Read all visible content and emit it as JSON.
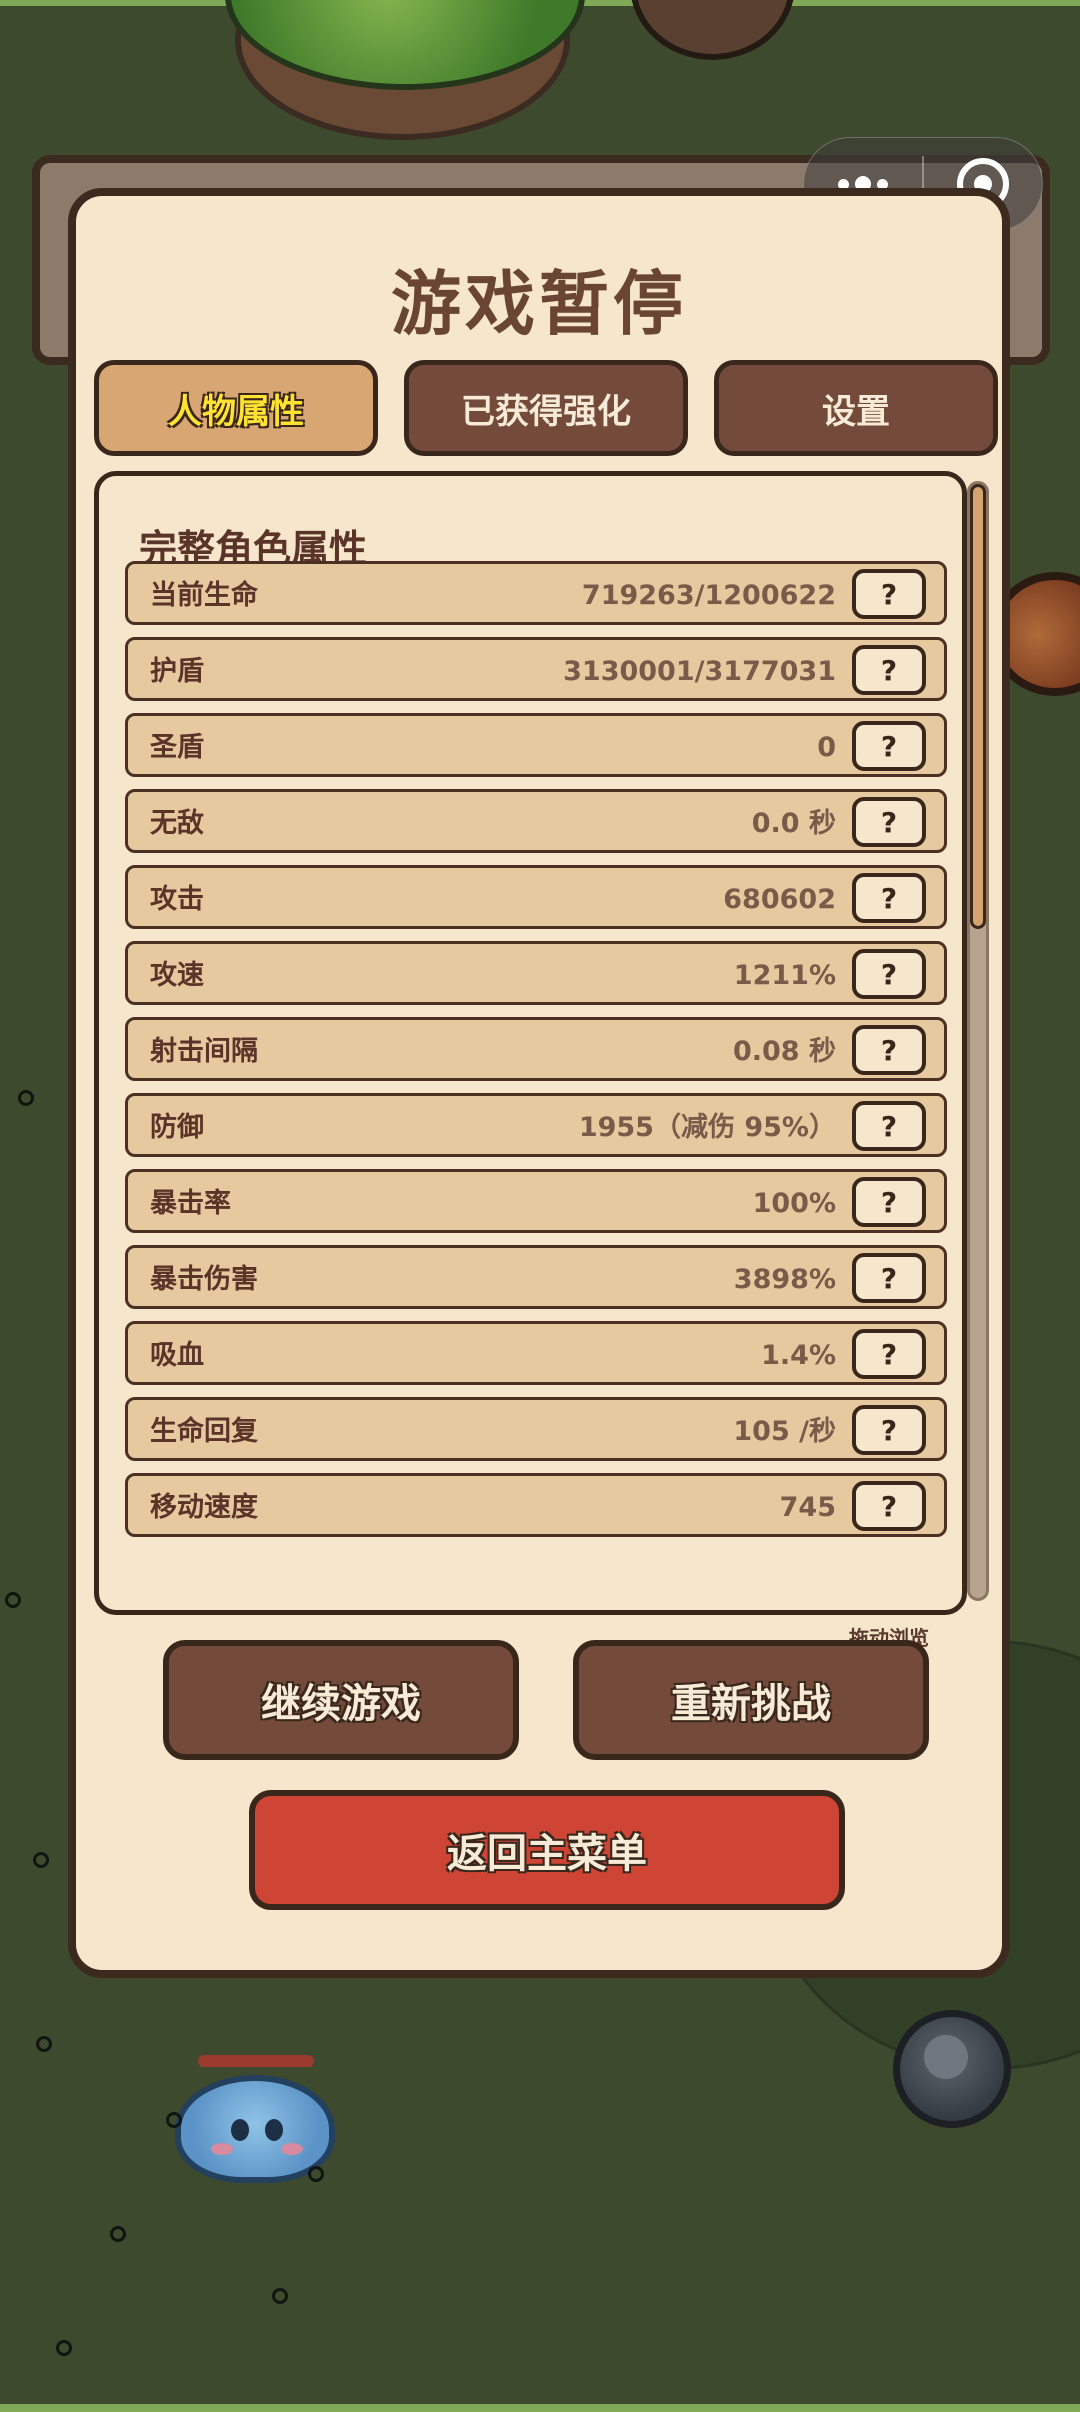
{
  "screen": {
    "title": "游戏暂停"
  },
  "tabs": [
    {
      "label": "人物属性",
      "active": true
    },
    {
      "label": "已获得强化",
      "active": false
    },
    {
      "label": "设置",
      "active": false
    }
  ],
  "stats": {
    "heading": "完整角色属性",
    "help_label": "?",
    "rows": [
      {
        "label": "当前生命",
        "value": "719263/1200622"
      },
      {
        "label": "护盾",
        "value": "3130001/3177031"
      },
      {
        "label": "圣盾",
        "value": "0"
      },
      {
        "label": "无敌",
        "value": "0.0 秒"
      },
      {
        "label": "攻击",
        "value": "680602"
      },
      {
        "label": "攻速",
        "value": "1211%"
      },
      {
        "label": "射击间隔",
        "value": "0.08 秒"
      },
      {
        "label": "防御",
        "value": "1955（减伤 95%）"
      },
      {
        "label": "暴击率",
        "value": "100%"
      },
      {
        "label": "暴击伤害",
        "value": "3898%"
      },
      {
        "label": "吸血",
        "value": "1.4%"
      },
      {
        "label": "生命回复",
        "value": "105 /秒"
      },
      {
        "label": "移动速度",
        "value": "745"
      }
    ],
    "scroll_hint": "拖动浏览"
  },
  "buttons": {
    "continue": "继续游戏",
    "retry": "重新挑战",
    "main_menu": "返回主菜单"
  },
  "colors": {
    "panel_bg": "#f6e6cb",
    "tab_active": "#d8a672",
    "tab_inactive": "#744b3a",
    "menu_button": "#cf4535",
    "outline": "#3a271c"
  },
  "icons": [
    "more-icon",
    "close-mini-program-icon"
  ]
}
